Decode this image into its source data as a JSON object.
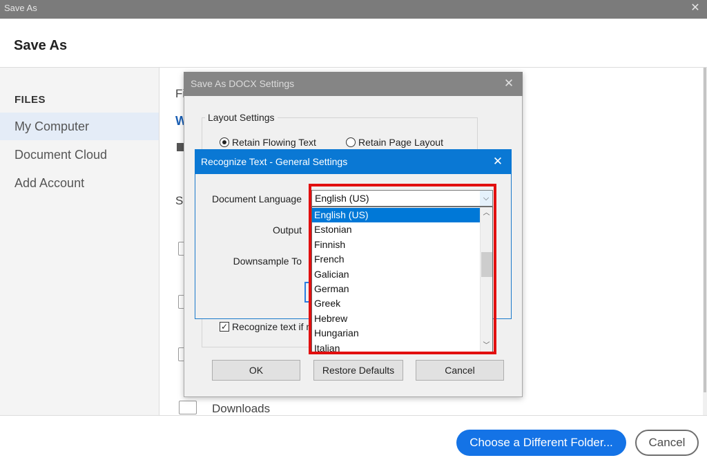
{
  "window": {
    "title": "Save As",
    "close_glyph": "✕"
  },
  "header": {
    "title": "Save As"
  },
  "sidebar": {
    "heading": "FILES",
    "items": [
      {
        "label": "My Computer",
        "selected": true
      },
      {
        "label": "Document Cloud",
        "selected": false
      },
      {
        "label": "Add Account",
        "selected": false
      }
    ]
  },
  "right_panel": {
    "frag_fi": "Fi",
    "frag_w": "W",
    "frag_sa": "Sa",
    "downloads_label": "Downloads"
  },
  "footer": {
    "choose_folder_label": "Choose a Different Folder...",
    "cancel_label": "Cancel"
  },
  "docx_dialog": {
    "title": "Save As DOCX Settings",
    "close_glyph": "✕",
    "layout_legend": "Layout Settings",
    "retain_flowing_label": "Retain Flowing Text",
    "retain_page_label": "Retain Page Layout",
    "recognize_label": "Recognize text if n",
    "ok_label": "OK",
    "restore_label": "Restore Defaults",
    "cancel_label": "Cancel"
  },
  "ocr_dialog": {
    "title": "Recognize Text - General Settings",
    "close_glyph": "✕",
    "document_language_label": "Document Language",
    "output_label": "Output",
    "downsample_label": "Downsample To",
    "selected_language": "English (US)",
    "languages": [
      "English (US)",
      "Estonian",
      "Finnish",
      "French",
      "Galician",
      "German",
      "Greek",
      "Hebrew",
      "Hungarian",
      "Italian"
    ]
  },
  "colors": {
    "accent": "#1473e6",
    "dialog_title": "#0a78d4",
    "highlight": "#e20f0f",
    "selection": "#0078d7"
  },
  "icons": [
    "close-icon",
    "folder-icon",
    "chevron-down-icon",
    "chevron-up-icon",
    "radio-icon",
    "checkbox-icon"
  ]
}
